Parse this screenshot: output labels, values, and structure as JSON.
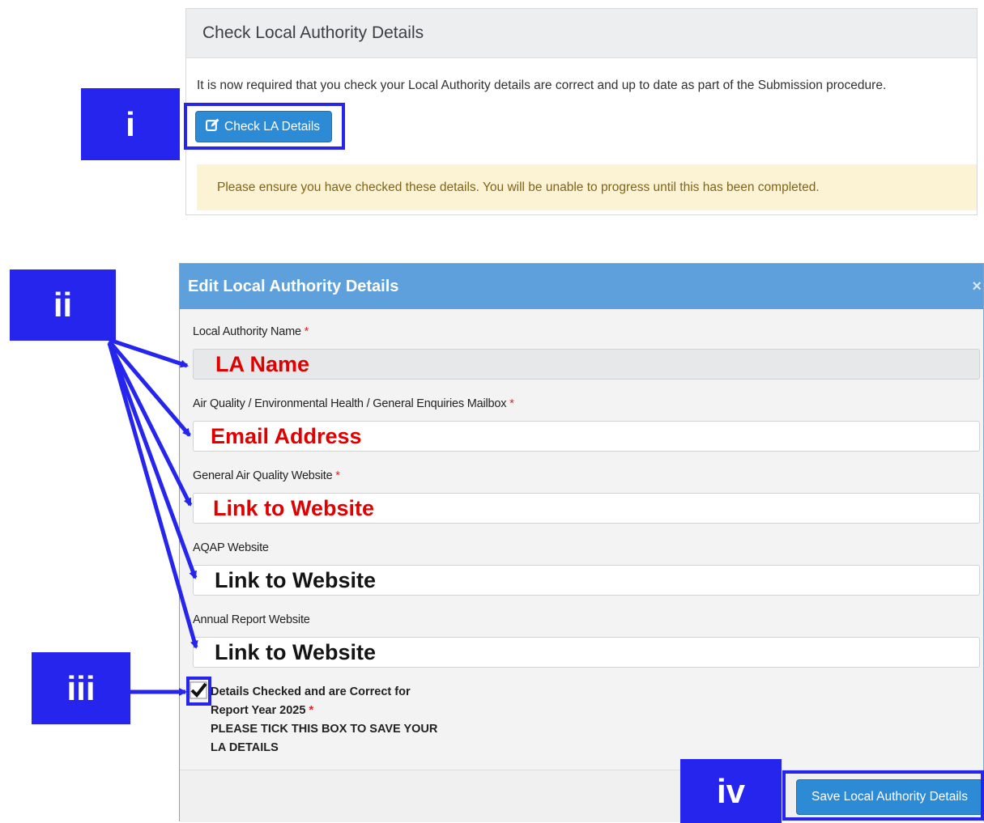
{
  "panel": {
    "title": "Check Local Authority Details",
    "description": "It is now required that you check your Local Authority details are correct and up to date as part of the Submission procedure.",
    "button_label": "Check LA Details",
    "button_icon": "edit-icon",
    "notice": "Please ensure you have checked these details. You will be unable to progress until this has been completed."
  },
  "modal": {
    "title": "Edit Local Authority Details",
    "close": "×",
    "fields": [
      {
        "label": "Local Authority Name",
        "required": "*",
        "value": "LA Name"
      },
      {
        "label": "Air Quality / Environmental Health / General Enquiries Mailbox",
        "required": "*",
        "value": "Email Address"
      },
      {
        "label": "General Air Quality Website",
        "required": "*",
        "value": "Link to Website"
      },
      {
        "label": "AQAP Website",
        "required": "",
        "value": "Link to Website"
      },
      {
        "label": "Annual Report Website",
        "required": "",
        "value": "Link to Website"
      }
    ],
    "consent": {
      "checked": true,
      "line1": "Details Checked and are Correct for",
      "line2": "Report Year 2025",
      "required": "*",
      "line3": "PLEASE TICK THIS BOX TO SAVE YOUR",
      "line4": "LA DETAILS"
    },
    "save_label": "Save Local Authority Details"
  },
  "callouts": {
    "i": "i",
    "ii": "ii",
    "iii": "iii",
    "iv": "iv"
  },
  "colors": {
    "annotation": "#2525ee",
    "primary_button": "#2d8ad5",
    "modal_header": "#5ea0dc",
    "warning_bg": "#fcf3d4",
    "required": "#d9262c",
    "placeholder_red": "#e00000"
  }
}
